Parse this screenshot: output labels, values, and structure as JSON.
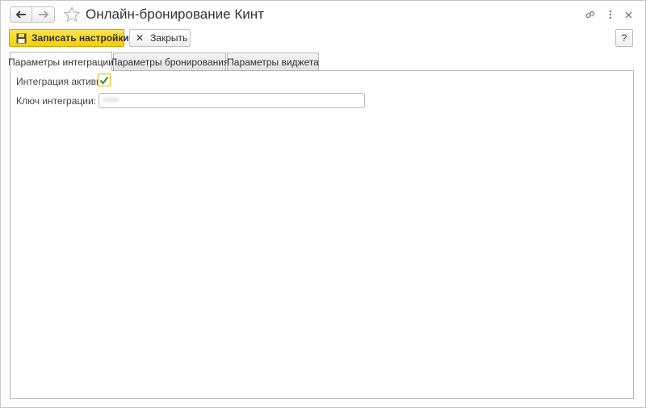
{
  "window": {
    "title": "Онлайн-бронирование Кинт"
  },
  "toolbar": {
    "save_label": "Записать настройки",
    "close_label": "Закрыть",
    "help_label": "?"
  },
  "tabs": [
    {
      "label": "Параметры интеграции",
      "active": true
    },
    {
      "label": "Параметры бронирования",
      "active": false
    },
    {
      "label": "Параметры виджета",
      "active": false
    }
  ],
  "form": {
    "integration_active_label": "Интеграция активна:",
    "integration_active_checked": true,
    "integration_key_label": "Ключ интеграции:",
    "integration_key_value": "•••••"
  },
  "colors": {
    "accent_yellow": "#f5cf0a",
    "check_green": "#2e9a3a",
    "focus_border": "#f0b400"
  }
}
